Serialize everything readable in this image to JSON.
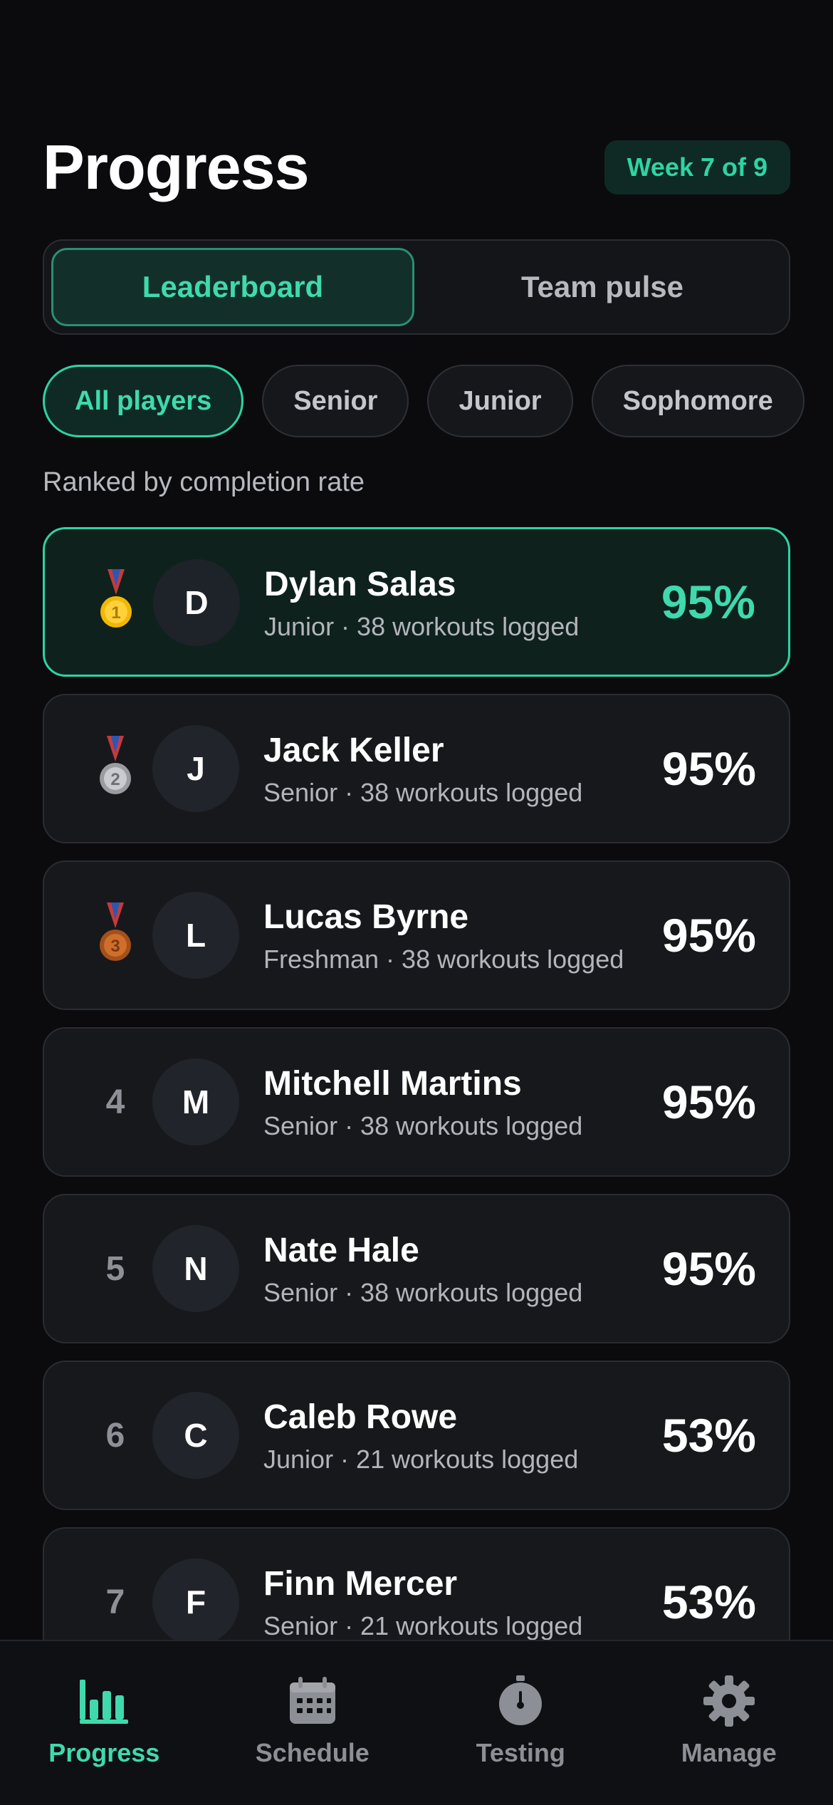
{
  "header": {
    "title": "Progress",
    "week_badge": "Week 7 of 9"
  },
  "tabs": [
    {
      "label": "Leaderboard",
      "active": true
    },
    {
      "label": "Team pulse",
      "active": false
    }
  ],
  "filters": [
    {
      "label": "All players",
      "active": true
    },
    {
      "label": "Senior",
      "active": false
    },
    {
      "label": "Junior",
      "active": false
    },
    {
      "label": "Sophomore",
      "active": false
    }
  ],
  "ranked_caption": "Ranked by completion rate",
  "players": [
    {
      "rank": "1",
      "medal": "gold-medal-icon",
      "initial": "D",
      "name": "Dylan Salas",
      "subtitle": "Junior · 38 workouts logged",
      "percent": "95%"
    },
    {
      "rank": "2",
      "medal": "silver-medal-icon",
      "initial": "J",
      "name": "Jack Keller",
      "subtitle": "Senior · 38 workouts logged",
      "percent": "95%"
    },
    {
      "rank": "3",
      "medal": "bronze-medal-icon",
      "initial": "L",
      "name": "Lucas Byrne",
      "subtitle": "Freshman · 38 workouts logged",
      "percent": "95%"
    },
    {
      "rank": "4",
      "initial": "M",
      "name": "Mitchell Martins",
      "subtitle": "Senior · 38 workouts logged",
      "percent": "95%"
    },
    {
      "rank": "5",
      "initial": "N",
      "name": "Nate Hale",
      "subtitle": "Senior · 38 workouts logged",
      "percent": "95%"
    },
    {
      "rank": "6",
      "initial": "C",
      "name": "Caleb Rowe",
      "subtitle": "Junior · 21 workouts logged",
      "percent": "53%"
    },
    {
      "rank": "7",
      "initial": "F",
      "name": "Finn Mercer",
      "subtitle": "Senior · 21 workouts logged",
      "percent": "53%"
    }
  ],
  "nav": [
    {
      "label": "Progress",
      "icon": "bar-chart-icon",
      "active": true
    },
    {
      "label": "Schedule",
      "icon": "calendar-icon",
      "active": false
    },
    {
      "label": "Testing",
      "icon": "stopwatch-icon",
      "active": false
    },
    {
      "label": "Manage",
      "icon": "gear-icon",
      "active": false
    }
  ],
  "colors": {
    "accent": "#2fd3a4",
    "background": "#0b0b0d",
    "card": "#17181c"
  }
}
